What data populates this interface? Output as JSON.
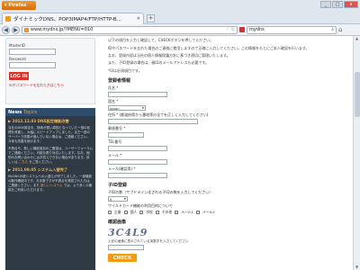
{
  "browser": {
    "app_button": "Firefox",
    "tab_title": "ダイナミックDNS、POP3IMAP4/FTP/HTTP-B...",
    "url": "www.mydns.jp/?MENU=010",
    "search_query": "mydns",
    "new_tab": "+",
    "window_controls": {
      "minimize": "_",
      "maximize": "□",
      "close": "x"
    }
  },
  "login": {
    "master_id_label": "MasterID",
    "password_label": "Password",
    "login_button": "LOG IN",
    "forgot_link": "IDやパスワードを忘れた方はこちら"
  },
  "news": {
    "title": "News",
    "subtitle": "Topics",
    "items": [
      {
        "date": "▶ 2012.12.03 DNS設定機能改善",
        "text": "当社のDNS設定を、検索が遅い原因となっていた一部の処理を改善し、大幅にスピードアップしました。まだ一部のサーバーで改善が進んでいない場合は、ご連絡ください。今後も改善を続けます。",
        "extra": "不具合や、新しい機能追加のご要望は、ユーザーフォーラムでご連絡ください。可能な限り対応いたします。なお、個別のお問い合わせにはお答えできない場合があります。詳しくは",
        "link": "こちら",
        "tail": "をご覧ください。"
      },
      {
        "date": "▶ 2011.09.05 システム入替完了",
        "text": "MyDNSの新システムへの入替えが完了しました。一部機能の動作確認中です。お手数ですが不具合を発見された方はご連絡ください。また",
        "link": "新しいシステム",
        "tail": "では、より多くの機能をご利用いただけます。"
      }
    ]
  },
  "form": {
    "intro": [
      "以下の項目を入力し確認して、CHECKボタンを押してください。",
      "IDやパスワードを忘れた場合のご連絡に使用しますので正確に入力してください。この情報をもとにご本人確認を行います。",
      "なお、登録内容は当社の個人情報保護方針に基づき適切に管理いたします。",
      "また、子ID登録の場合は、親IDのメールアドレスも必要です。"
    ],
    "note": "*印は必須項目です。",
    "section_user": "登録者情報",
    "fields": {
      "name": "氏名 *",
      "country": "国名 *",
      "country_value": "Japan",
      "address": "住所 * (都道府県から番地等の全てを正しく入力してください)",
      "zip": "郵便番号 *",
      "tel": "TEL番号",
      "email": "メール *",
      "email_confirm": "メール(確認用) *"
    },
    "section_child": "子ID登録",
    "child_note": "子IDの数（サブドメイン化される子IDの数を入力してください）",
    "child_value": "0",
    "reason_label": "ワイルドカード機能の利用目的について",
    "reason_options": [
      "企業",
      "個人",
      "学校",
      "その他",
      "メール1",
      "メール2"
    ],
    "section_captcha": "確認画像",
    "captcha_text": "3C4L9",
    "captcha_note": "上記の画像に表示されている英数字を入力してください",
    "check_button": "CHECK"
  }
}
